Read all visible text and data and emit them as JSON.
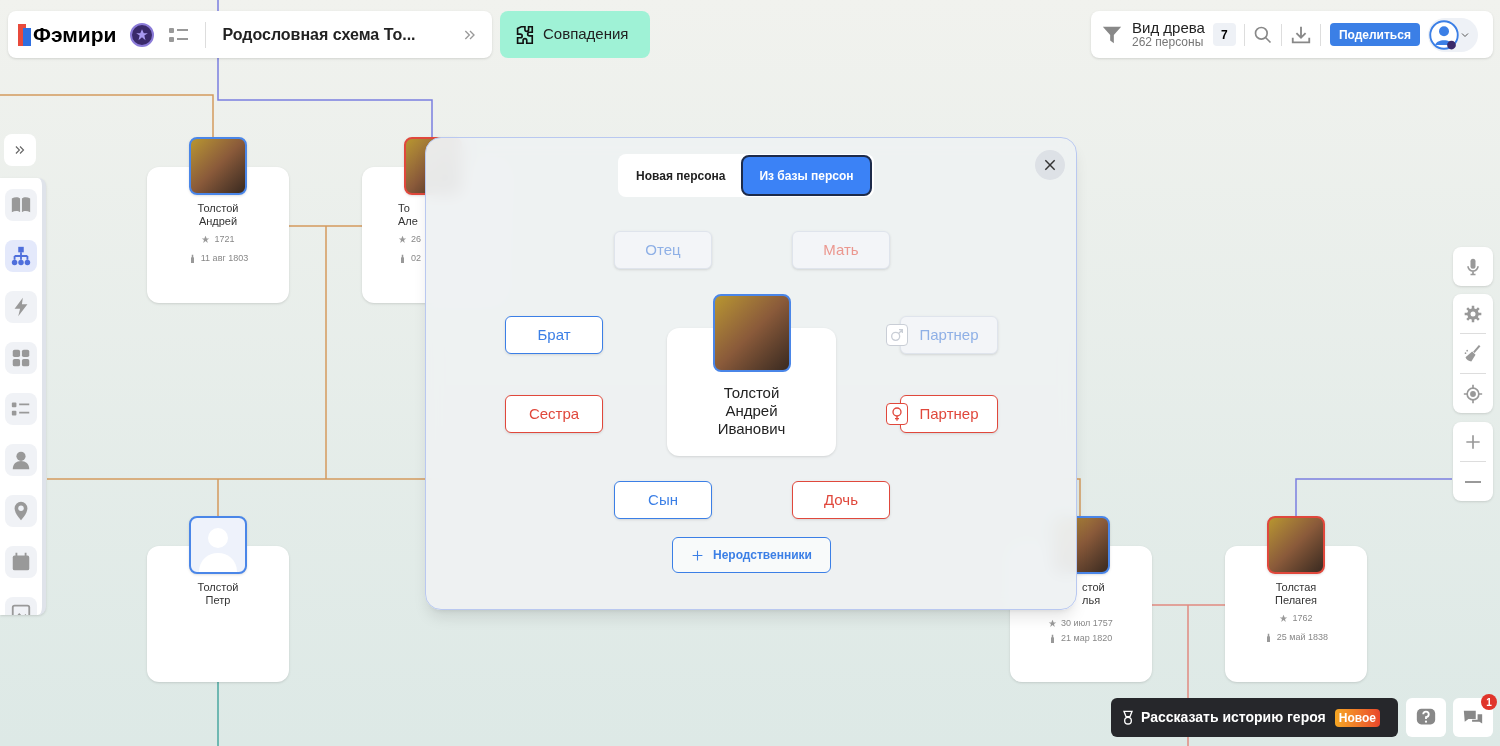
{
  "header": {
    "logo": "Фэмири",
    "tree_title": "Родословная схема То...",
    "matches_button": "Совпадения"
  },
  "view": {
    "title": "Вид древа",
    "count": "262 персоны",
    "filter_count": "7",
    "share_button": "Поделиться"
  },
  "sidebar": {
    "items": [
      {
        "selected": false
      },
      {
        "selected": true
      },
      {
        "selected": false
      },
      {
        "selected": false
      },
      {
        "selected": false
      },
      {
        "selected": false
      },
      {
        "selected": false
      },
      {
        "selected": false
      },
      {
        "selected": false
      }
    ]
  },
  "persons": [
    {
      "color": "#4a86e8",
      "photo": true,
      "name_lines": [
        "Толстой",
        "Андрей"
      ],
      "birth": "1721",
      "death": "11 авг 1803"
    },
    {
      "color": "#e0483c",
      "photo": true,
      "name_lines": [
        "То",
        "Але"
      ],
      "birth": "26",
      "death": "02"
    },
    {
      "color": "#4a86e8",
      "photo": false,
      "name_lines": [
        "Толстой",
        "Петр"
      ]
    },
    {
      "color": "#4a86e8",
      "photo": true,
      "name_lines": [
        "стой",
        "лья"
      ],
      "birth": "30 июл 1757",
      "death": "21 мар 1820"
    },
    {
      "color": "#e0483c",
      "photo": true,
      "name_lines": [
        "Толстая",
        "Пелагея"
      ],
      "birth": "1762",
      "death": "25 май 1838"
    }
  ],
  "dialog": {
    "tabs": [
      {
        "label": "Новая персона",
        "selected": false
      },
      {
        "label": "Из базы персон",
        "selected": true
      }
    ],
    "relations": [
      {
        "label": "Отец",
        "color": "#8fb0e6",
        "kind": "relative",
        "disabled": true
      },
      {
        "label": "Мать",
        "color": "#eb978f",
        "kind": "relative",
        "disabled": true
      },
      {
        "label": "Брат",
        "color": "#3b7fe6",
        "kind": "relative",
        "disabled": false
      },
      {
        "label": "Сестра",
        "color": "#e0483c",
        "kind": "relative",
        "disabled": false
      },
      {
        "label": "Партнер",
        "color": "#8fb0e6",
        "kind": "male_partner",
        "disabled": true
      },
      {
        "label": "Партнер",
        "color": "#e0483c",
        "kind": "female_partner",
        "disabled": false
      },
      {
        "label": "Сын",
        "color": "#3b7fe6",
        "kind": "relative",
        "disabled": false
      },
      {
        "label": "Дочь",
        "color": "#e0483c",
        "kind": "relative",
        "disabled": false
      }
    ],
    "person_lines": [
      "Толстой",
      "Андрей",
      "Иванович"
    ],
    "other_button": "Неродственники"
  },
  "story": {
    "label": "Рассказать историю героя",
    "badge": "Новое"
  },
  "chat_badge": "1"
}
